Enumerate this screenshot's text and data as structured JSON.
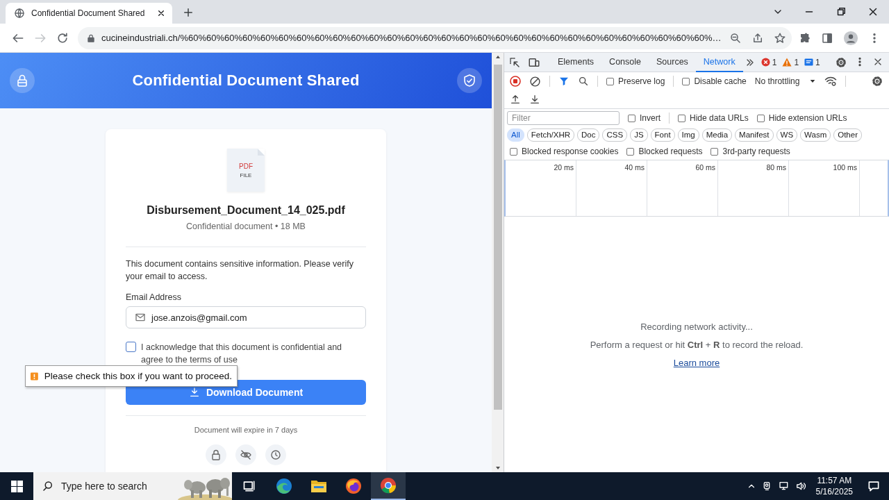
{
  "browser": {
    "tabs": [
      {
        "title": "Confidential Document Shared",
        "selected": true
      }
    ],
    "forward_disabled": true,
    "url": "cucineindustriali.ch/%60%60%60%60%60%60%60%60%60%60%60%60%60%60%60%60%60%60%60%60%60%60%60%60%60%60%60%60%60%…"
  },
  "page": {
    "title": "Confidential Document Shared",
    "file": {
      "type": "PDF",
      "caption": "FILE",
      "name": "Disbursement_Document_14_025.pdf",
      "meta": "Confidential document • 18 MB"
    },
    "notice": "This document contains sensitive information. Please verify your email to access.",
    "email": {
      "label": "Email Address",
      "value": "jose.anzois@gmail.com"
    },
    "consent": {
      "label": "I acknowledge that this document is confidential and agree to the terms of use",
      "checked": false
    },
    "button": "Download Document",
    "expiry": "Document will expire in 7 days",
    "validation_tooltip": "Please check this box if you want to proceed."
  },
  "devtools": {
    "tabs": [
      {
        "label": "Elements",
        "selected": false
      },
      {
        "label": "Console",
        "selected": false
      },
      {
        "label": "Sources",
        "selected": false
      },
      {
        "label": "Network",
        "selected": true
      }
    ],
    "issues": [
      {
        "kind": "error",
        "count": "1"
      },
      {
        "kind": "warning",
        "count": "1"
      },
      {
        "kind": "info",
        "count": "1"
      }
    ],
    "recording": true,
    "options": [
      {
        "label": "Preserve log",
        "checked": false
      },
      {
        "label": "Disable cache",
        "checked": false
      }
    ],
    "throttling": "No throttling",
    "filter_placeholder": "Filter",
    "filter_options": [
      {
        "label": "Invert",
        "checked": false
      },
      {
        "label": "Hide data URLs",
        "checked": false
      },
      {
        "label": "Hide extension URLs",
        "checked": false
      }
    ],
    "types": [
      {
        "label": "All",
        "selected": true
      },
      {
        "label": "Fetch/XHR",
        "selected": false
      },
      {
        "label": "Doc",
        "selected": false
      },
      {
        "label": "CSS",
        "selected": false
      },
      {
        "label": "JS",
        "selected": false
      },
      {
        "label": "Font",
        "selected": false
      },
      {
        "label": "Img",
        "selected": false
      },
      {
        "label": "Media",
        "selected": false
      },
      {
        "label": "Manifest",
        "selected": false
      },
      {
        "label": "WS",
        "selected": false
      },
      {
        "label": "Wasm",
        "selected": false
      },
      {
        "label": "Other",
        "selected": false
      }
    ],
    "blocked_options": [
      {
        "label": "Blocked response cookies",
        "checked": false
      },
      {
        "label": "Blocked requests",
        "checked": false
      },
      {
        "label": "3rd-party requests",
        "checked": false
      }
    ],
    "timeline_ticks": [
      "20 ms",
      "40 ms",
      "60 ms",
      "80 ms",
      "100 ms"
    ],
    "empty_state": {
      "title": "Recording network activity...",
      "hint": "Perform a request or hit **Ctrl** + **R** to record the reload.",
      "link": "Learn more"
    }
  },
  "taskbar": {
    "search_placeholder": "Type here to search",
    "time": "11:57 AM",
    "date": "5/16/2025"
  }
}
